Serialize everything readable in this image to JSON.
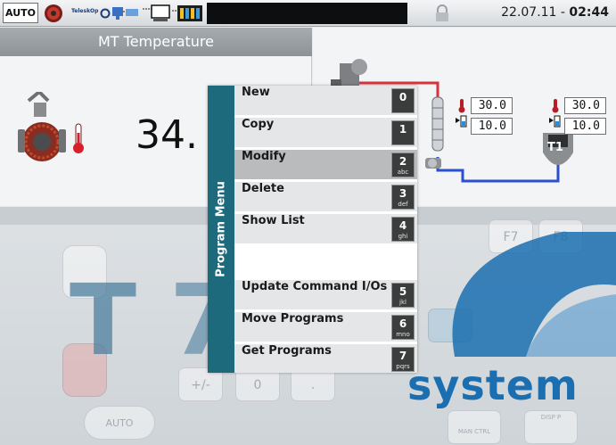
{
  "topbar": {
    "mode": "AUTO",
    "telescope_label": "TeleskOp",
    "date": "22.07.11 - ",
    "time": "02:44"
  },
  "header": {
    "title": "MT Temperature"
  },
  "main": {
    "value": "34."
  },
  "diagram": {
    "readouts": [
      {
        "value": "30.0"
      },
      {
        "value": "10.0"
      },
      {
        "value": "30.0"
      },
      {
        "value": "10.0"
      }
    ],
    "unit_label": "T1",
    "colors": {
      "hot_line": "#d8323b",
      "cold_line": "#2a4fd0"
    }
  },
  "menu": {
    "title": "Program Menu",
    "accent_color": "#1d6a7d",
    "items": [
      {
        "label": "New",
        "key": "0",
        "sub": ""
      },
      {
        "label": "Copy",
        "key": "1",
        "sub": ""
      },
      {
        "label": "Modify",
        "key": "2",
        "sub": "abc",
        "selected": true
      },
      {
        "label": "Delete",
        "key": "3",
        "sub": "def"
      },
      {
        "label": "Show List",
        "key": "4",
        "sub": "ghi"
      },
      {
        "label": "",
        "key": "",
        "sub": ""
      },
      {
        "label": "Update Command I/Os",
        "key": "5",
        "sub": "jkl"
      },
      {
        "label": "Move Programs",
        "key": "6",
        "sub": "mno"
      },
      {
        "label": "Get Programs",
        "key": "7",
        "sub": "pqrs"
      }
    ]
  },
  "background": {
    "brand_word": "system",
    "brand_letter_1": "T",
    "brand_letter_2": "7",
    "keypad": [
      "+/-",
      "0",
      ".",
      "F7",
      "F8",
      "AUTO",
      "MAN CTRL",
      "DISP P"
    ]
  }
}
